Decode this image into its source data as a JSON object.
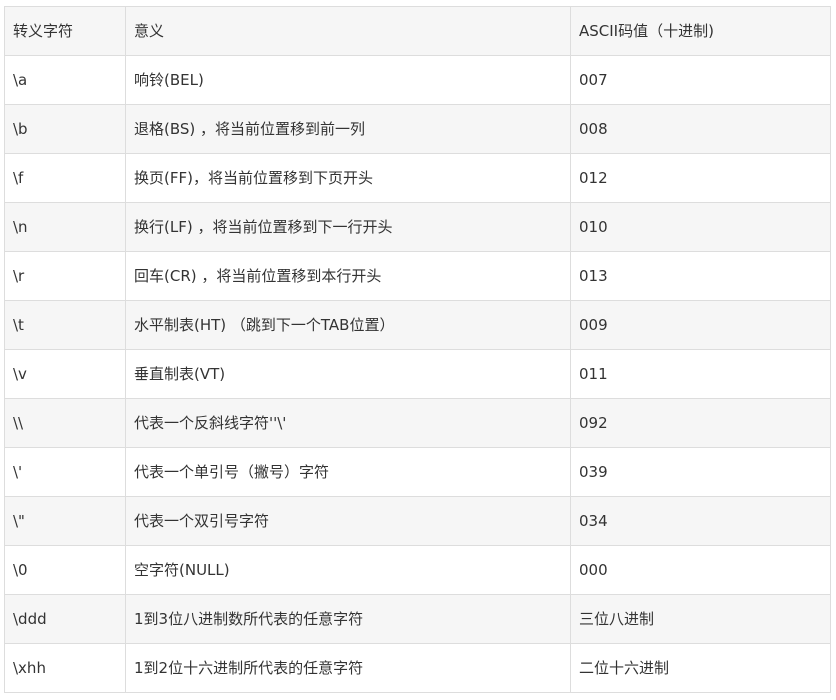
{
  "table": {
    "headers": [
      "转义字符",
      "意义",
      "ASCII码值（十进制)"
    ],
    "rows": [
      [
        "\\a",
        "响铃(BEL)",
        "007"
      ],
      [
        "\\b",
        "退格(BS) ，将当前位置移到前一列",
        "008"
      ],
      [
        "\\f",
        "换页(FF)，将当前位置移到下页开头",
        "012"
      ],
      [
        "\\n",
        "换行(LF) ，将当前位置移到下一行开头",
        "010"
      ],
      [
        "\\r",
        "回车(CR) ，将当前位置移到本行开头",
        "013"
      ],
      [
        "\\t",
        "水平制表(HT) （跳到下一个TAB位置）",
        "009"
      ],
      [
        "\\v",
        "垂直制表(VT)",
        "011"
      ],
      [
        "\\\\",
        "代表一个反斜线字符''\\'",
        "092"
      ],
      [
        "\\'",
        "代表一个单引号（撇号）字符",
        "039"
      ],
      [
        "\\\"",
        "代表一个双引号字符",
        "034"
      ],
      [
        "\\0",
        "空字符(NULL)",
        "000"
      ],
      [
        "\\ddd",
        "1到3位八进制数所代表的任意字符",
        "三位八进制"
      ],
      [
        "\\xhh",
        "1到2位十六进制所代表的任意字符",
        "二位十六进制"
      ]
    ]
  }
}
